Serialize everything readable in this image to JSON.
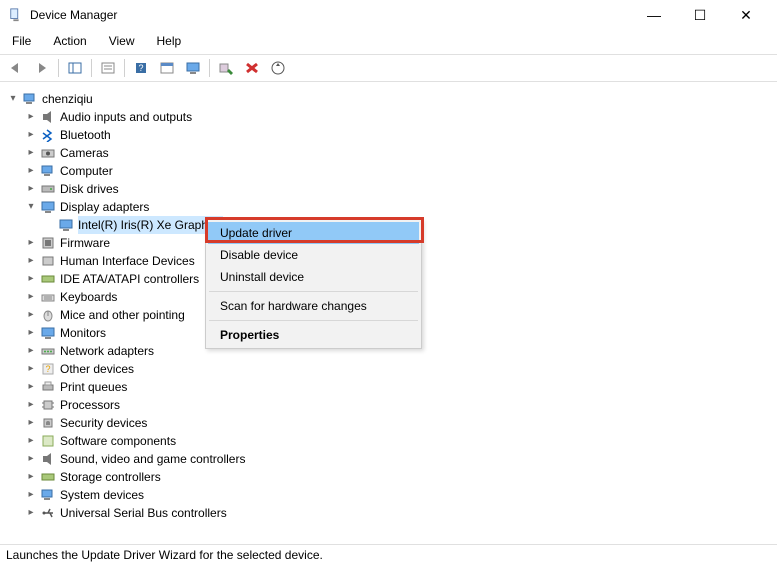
{
  "window": {
    "title": "Device Manager"
  },
  "menubar": [
    "File",
    "Action",
    "View",
    "Help"
  ],
  "tree": {
    "root": "chenziqiu",
    "items": [
      {
        "label": "Audio inputs and outputs",
        "exp": "closed"
      },
      {
        "label": "Bluetooth",
        "exp": "closed"
      },
      {
        "label": "Cameras",
        "exp": "closed"
      },
      {
        "label": "Computer",
        "exp": "closed"
      },
      {
        "label": "Disk drives",
        "exp": "closed"
      },
      {
        "label": "Display adapters",
        "exp": "open",
        "children": [
          {
            "label": "Intel(R) Iris(R) Xe Graphics",
            "selected": true
          }
        ]
      },
      {
        "label": "Firmware",
        "exp": "closed"
      },
      {
        "label": "Human Interface Devices",
        "exp": "closed",
        "truncated": true
      },
      {
        "label": "IDE ATA/ATAPI controllers",
        "exp": "closed",
        "truncated": true
      },
      {
        "label": "Keyboards",
        "exp": "closed"
      },
      {
        "label": "Mice and other pointing",
        "exp": "closed",
        "truncated": true
      },
      {
        "label": "Monitors",
        "exp": "closed"
      },
      {
        "label": "Network adapters",
        "exp": "closed"
      },
      {
        "label": "Other devices",
        "exp": "closed"
      },
      {
        "label": "Print queues",
        "exp": "closed"
      },
      {
        "label": "Processors",
        "exp": "closed"
      },
      {
        "label": "Security devices",
        "exp": "closed"
      },
      {
        "label": "Software components",
        "exp": "closed"
      },
      {
        "label": "Sound, video and game controllers",
        "exp": "closed"
      },
      {
        "label": "Storage controllers",
        "exp": "closed"
      },
      {
        "label": "System devices",
        "exp": "closed"
      },
      {
        "label": "Universal Serial Bus controllers",
        "exp": "closed"
      }
    ]
  },
  "contextmenu": {
    "items": [
      {
        "label": "Update driver",
        "hover": true
      },
      {
        "label": "Disable device"
      },
      {
        "label": "Uninstall device"
      },
      {
        "sep": true
      },
      {
        "label": "Scan for hardware changes"
      },
      {
        "sep": true
      },
      {
        "label": "Properties",
        "bold": true
      }
    ]
  },
  "statusbar": "Launches the Update Driver Wizard for the selected device."
}
